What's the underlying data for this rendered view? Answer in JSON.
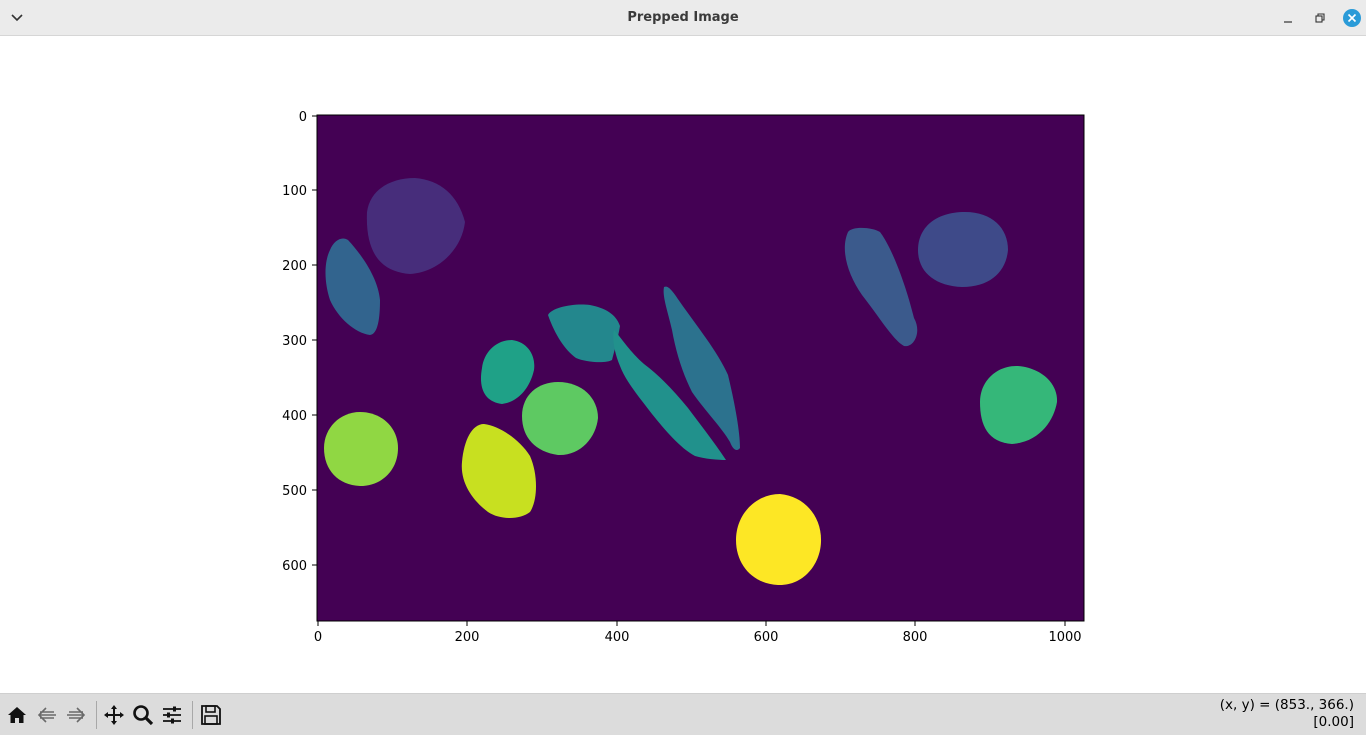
{
  "window": {
    "title": "Prepped Image",
    "menu_icon": "chevron-down-icon",
    "minimize_icon": "minimize-icon",
    "maximize_icon": "restore-icon",
    "close_icon": "close-icon",
    "close_color": "#2a9bd8"
  },
  "figure": {
    "background_color": "#440154",
    "x_ticks": [
      "0",
      "200",
      "400",
      "600",
      "800",
      "1000"
    ],
    "y_ticks": [
      "0",
      "100",
      "200",
      "300",
      "400",
      "500",
      "600"
    ],
    "xlim": [
      0,
      1024
    ],
    "ylim": [
      0,
      678
    ],
    "regions": [
      {
        "label": 1,
        "color": "#472d7b"
      },
      {
        "label": 2,
        "color": "#3e4a89"
      },
      {
        "label": 3,
        "color": "#31688e"
      },
      {
        "label": 4,
        "color": "#2c728e"
      },
      {
        "label": 5,
        "color": "#27818e"
      },
      {
        "label": 6,
        "color": "#21918c"
      },
      {
        "label": 7,
        "color": "#1fa187"
      },
      {
        "label": 8,
        "color": "#35b779"
      },
      {
        "label": 9,
        "color": "#5ec962"
      },
      {
        "label": 10,
        "color": "#90d743"
      },
      {
        "label": 11,
        "color": "#c8e020"
      },
      {
        "label": 12,
        "color": "#fde725"
      }
    ]
  },
  "toolbar": {
    "tools": [
      {
        "name": "home-icon"
      },
      {
        "name": "back-icon"
      },
      {
        "name": "forward-icon"
      },
      {
        "name": "pan-icon"
      },
      {
        "name": "zoom-icon"
      },
      {
        "name": "configure-subplots-icon"
      },
      {
        "name": "save-icon"
      }
    ],
    "coords_line1": "(x, y) = (853., 366.)",
    "coords_line2": "[0.00]"
  }
}
